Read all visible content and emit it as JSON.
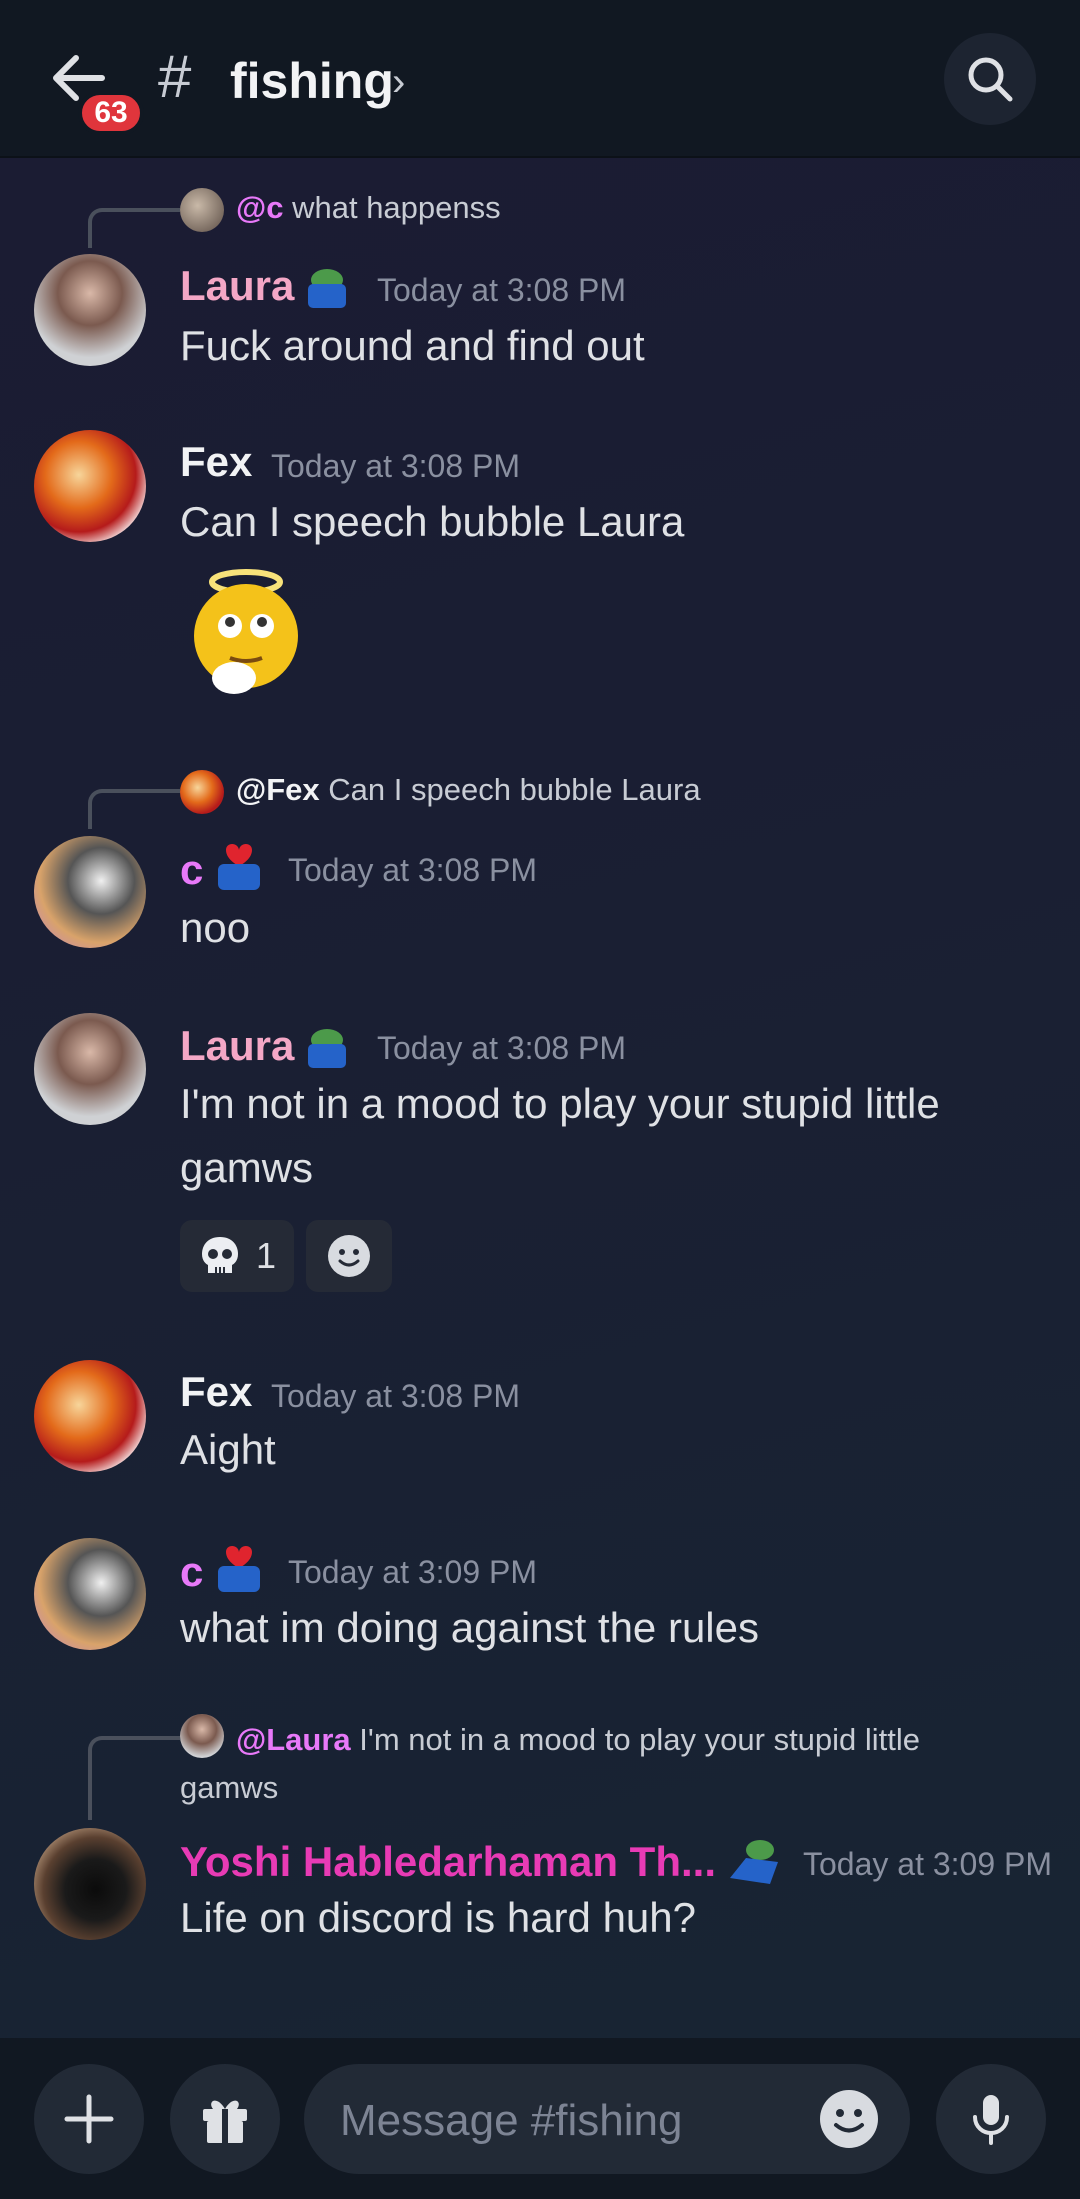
{
  "header": {
    "unread_count": "63",
    "channel_hash": "#",
    "channel_name": "fishing",
    "chevron": "›"
  },
  "messages": [
    {
      "reply": {
        "mention": "@c",
        "text": "what happenss"
      },
      "author": "Laura",
      "author_color": "#f4a7c6",
      "timestamp": "Today at 3:08 PM",
      "text": "Fuck around and find out"
    },
    {
      "author": "Fex",
      "author_color": "#f2f3f5",
      "timestamp": "Today at 3:08 PM",
      "text": "Can I speech bubble Laura",
      "sticker": "angel-emoji"
    },
    {
      "reply": {
        "mention": "@Fex",
        "text": "Can I speech bubble Laura"
      },
      "author": "c",
      "author_color": "#e879f9",
      "timestamp": "Today at 3:08 PM",
      "text": "noo"
    },
    {
      "author": "Laura",
      "author_color": "#f4a7c6",
      "timestamp": "Today at 3:08 PM",
      "text": "I'm not in a mood to play your stupid little gamws",
      "reactions": [
        {
          "emoji": "skull",
          "count": "1"
        }
      ]
    },
    {
      "author": "Fex",
      "author_color": "#f2f3f5",
      "timestamp": "Today at 3:08 PM",
      "text": "Aight"
    },
    {
      "author": "c",
      "author_color": "#e879f9",
      "timestamp": "Today at 3:09 PM",
      "text": "what im doing against the rules"
    },
    {
      "reply": {
        "mention": "@Laura",
        "text": "I'm not in a mood to play your stupid little gamws"
      },
      "author": "Yoshi Habledarhaman Th...",
      "author_color": "#e83bb5",
      "timestamp": "Today at 3:09 PM",
      "text": "Life on discord is hard huh?"
    }
  ],
  "composer": {
    "placeholder": "Message #fishing"
  },
  "colors": {
    "header_bg": "#111822",
    "badge": "#e0353c",
    "mention": "#e879f9"
  }
}
